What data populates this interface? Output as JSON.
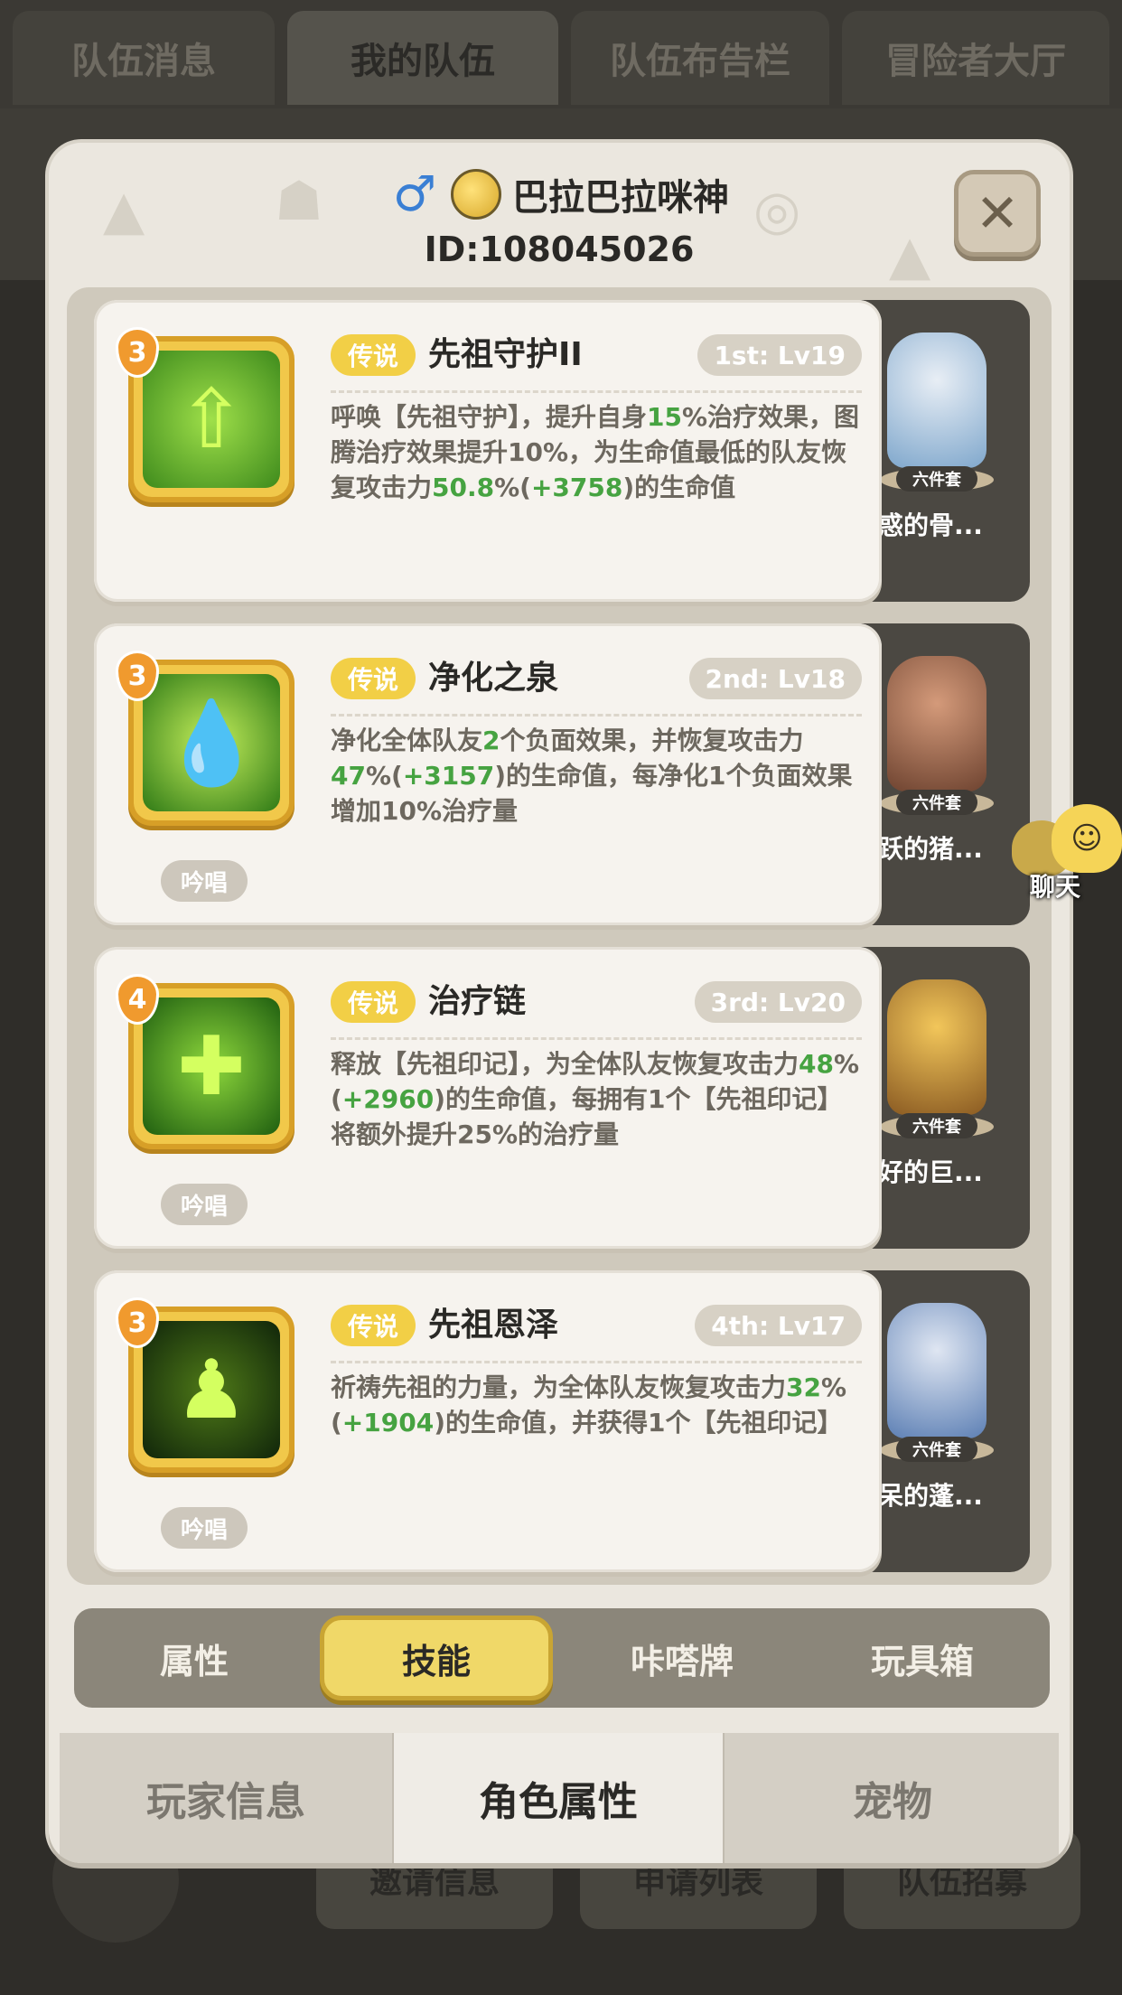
{
  "top_tabs": [
    "队伍消息",
    "我的队伍",
    "队伍布告栏",
    "冒险者大厅"
  ],
  "background_buttons": [
    "邀请信息",
    "申请列表",
    "队伍招募"
  ],
  "header": {
    "player_name": "巴拉巴拉咪神",
    "player_id": "ID:108045026",
    "close_symbol": "✕",
    "gender_symbol": "♂"
  },
  "skills": [
    {
      "level": "3",
      "rarity": "传说",
      "name": "先祖守护II",
      "rank": "1st: Lv19",
      "desc_parts": [
        "呼唤【先祖守护】，提升自身",
        "15",
        "%治疗效果，图腾治疗效果提升10%，为生命值最低的队友恢复攻击力",
        "50.8",
        "%(",
        "+3758",
        ")的生命值"
      ],
      "chant": "",
      "figure_name": "困惑的骨...",
      "set_label": "六件套",
      "icon": "up-arrow"
    },
    {
      "level": "3",
      "rarity": "传说",
      "name": "净化之泉",
      "rank": "2nd: Lv18",
      "desc_parts": [
        "净化全体队友",
        "2",
        "个负面效果，并恢复攻击力",
        "47",
        "%(",
        "+3157",
        ")的生命值，每净化1个负面效果增加10%治疗量"
      ],
      "chant": "吟唱",
      "figure_name": "活跃的猪...",
      "set_label": "六件套",
      "icon": "drop"
    },
    {
      "level": "4",
      "rarity": "传说",
      "name": "治疗链",
      "rank": "3rd: Lv20",
      "desc_parts": [
        "释放【先祖印记】，为全体队友恢复攻击力",
        "48",
        "%(",
        "+2960",
        ")的生命值，每拥有1个【先祖印记】将额外提升25%的治疗量"
      ],
      "chant": "吟唱",
      "figure_name": "友好的巨...",
      "set_label": "六件套",
      "icon": "chain"
    },
    {
      "level": "3",
      "rarity": "传说",
      "name": "先祖恩泽",
      "rank": "4th: Lv17",
      "desc_parts": [
        "祈祷先祖的力量，为全体队友恢复攻击力",
        "32",
        "%(",
        "+1904",
        ")的生命值，并获得1个【先祖印记】"
      ],
      "chant": "吟唱",
      "figure_name": "发呆的蓬...",
      "set_label": "六件套",
      "icon": "spirit"
    }
  ],
  "inner_tabs": [
    "属性",
    "技能",
    "咔嗒牌",
    "玩具箱"
  ],
  "footer_tabs": [
    "玩家信息",
    "角色属性",
    "宠物"
  ],
  "chat_label": "聊天",
  "colors": {
    "highlight_green": "#46a341",
    "gold": "#f2cf46",
    "panel": "#ebe7df"
  }
}
